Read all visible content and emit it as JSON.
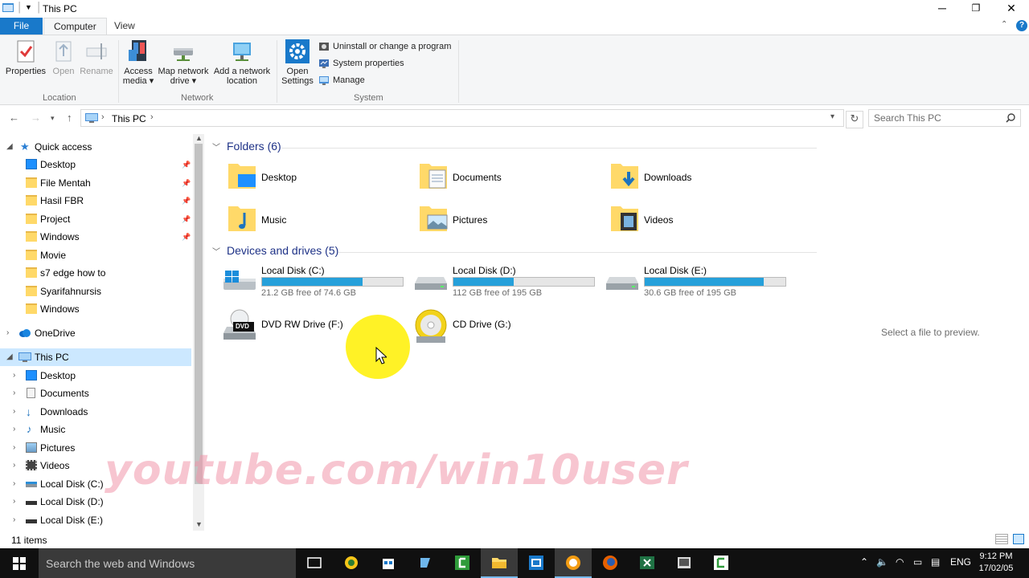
{
  "window": {
    "title": "This PC",
    "controls": {
      "minimize": "─",
      "restore": "❐",
      "close": "✕"
    }
  },
  "ribbon": {
    "tabs": [
      "File",
      "Computer",
      "View"
    ],
    "location": {
      "label": "Location",
      "properties": "Properties",
      "open": "Open",
      "rename": "Rename"
    },
    "network": {
      "label": "Network",
      "access_media_1": "Access",
      "access_media_2": "media ▾",
      "map_drive_1": "Map network",
      "map_drive_2": "drive ▾",
      "add_location_1": "Add a network",
      "add_location_2": "location"
    },
    "system": {
      "label": "System",
      "open_settings_1": "Open",
      "open_settings_2": "Settings",
      "uninstall": "Uninstall or change a program",
      "system_properties": "System properties",
      "manage": "Manage"
    }
  },
  "address": {
    "breadcrumb": "This PC",
    "separator": "›",
    "search_placeholder": "Search This PC"
  },
  "nav": {
    "quick_access": "Quick access",
    "quick_items": [
      {
        "label": "Desktop",
        "pinned": true
      },
      {
        "label": "File Mentah",
        "pinned": true
      },
      {
        "label": "Hasil FBR",
        "pinned": true
      },
      {
        "label": "Project",
        "pinned": true
      },
      {
        "label": "Windows",
        "pinned": true
      },
      {
        "label": "Movie",
        "pinned": false
      },
      {
        "label": "s7 edge how to",
        "pinned": false
      },
      {
        "label": "Syarifahnursis",
        "pinned": false
      },
      {
        "label": "Windows",
        "pinned": false
      }
    ],
    "onedrive": "OneDrive",
    "this_pc": "This PC",
    "pc_items": [
      "Desktop",
      "Documents",
      "Downloads",
      "Music",
      "Pictures",
      "Videos",
      "Local Disk (C:)",
      "Local Disk (D:)",
      "Local Disk (E:)"
    ]
  },
  "content": {
    "folders_header": "Folders (6)",
    "folders": [
      "Desktop",
      "Documents",
      "Downloads",
      "Music",
      "Pictures",
      "Videos"
    ],
    "drives_header": "Devices and drives (5)",
    "drives": [
      {
        "name": "Local Disk (C:)",
        "free": "21.2 GB free of 74.6 GB",
        "used_fraction": 0.716
      },
      {
        "name": "Local Disk (D:)",
        "free": "112 GB free of 195 GB",
        "used_fraction": 0.426
      },
      {
        "name": "Local Disk (E:)",
        "free": "30.6 GB free of 195 GB",
        "used_fraction": 0.843
      }
    ],
    "devices": [
      {
        "name": "DVD RW Drive (F:)",
        "badge": "DVD"
      },
      {
        "name": "CD Drive (G:)"
      }
    ]
  },
  "preview": {
    "text": "Select a file to preview."
  },
  "status": {
    "items_count": "11 items"
  },
  "watermark": "youtube.com/win10user",
  "taskbar": {
    "search_placeholder": "Search the web and Windows",
    "language": "ENG",
    "time": "9:12 PM",
    "date": "17/02/05"
  },
  "colors": {
    "accent": "#1979ca",
    "drive_fill": "#26a0da",
    "group_header": "#1e3287",
    "selection": "#cce8ff",
    "folder": "#ffd969"
  }
}
